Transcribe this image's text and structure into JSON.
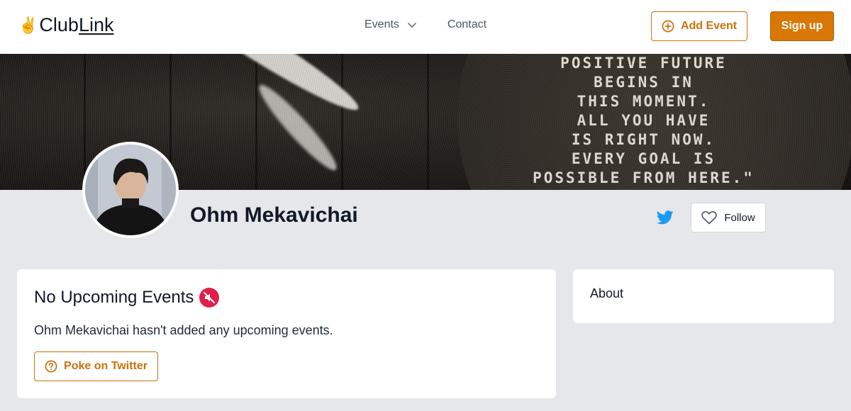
{
  "header": {
    "logo_emoji": "✌",
    "logo_text_a": "Club",
    "logo_text_b": "Link",
    "nav": {
      "events_label": "Events",
      "contact_label": "Contact"
    },
    "add_event_label": "Add Event",
    "sign_up_label": "Sign up"
  },
  "banner": {
    "quote_lines": [
      "POSITIVE FUTURE",
      "BEGINS IN",
      "THIS MOMENT.",
      "ALL YOU HAVE",
      "IS RIGHT NOW.",
      "EVERY GOAL IS",
      "POSSIBLE FROM HERE.\""
    ]
  },
  "profile": {
    "name": "Ohm Mekavichai",
    "follow_label": "Follow",
    "twitter_icon": "twitter-icon"
  },
  "events": {
    "title": "No Upcoming Events",
    "title_icon": "muted-speaker-icon",
    "description": "Ohm Mekavichai hasn't added any upcoming events.",
    "poke_label": "Poke on Twitter"
  },
  "about": {
    "title": "About"
  },
  "colors": {
    "accent": "#d97706",
    "accent_border": "#c8720c",
    "twitter": "#1d9bf0",
    "page_bg": "#e5e7eb"
  }
}
